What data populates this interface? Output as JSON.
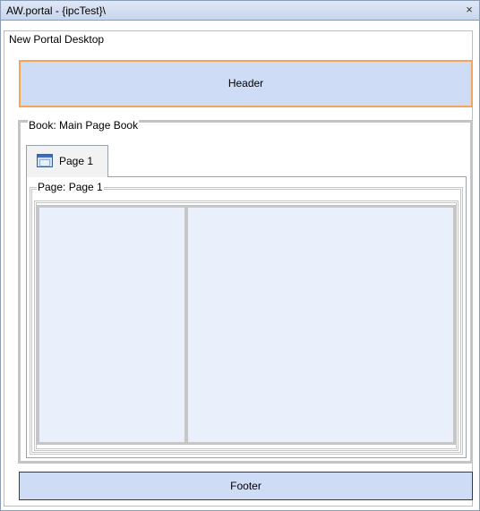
{
  "window": {
    "title": "AW.portal - {ipcTest}\\",
    "close_label": "×"
  },
  "desktop": {
    "legend": "New Portal Desktop",
    "header_label": "Header",
    "footer_label": "Footer"
  },
  "book": {
    "legend": "Book: Main Page Book",
    "tabs": [
      {
        "label": "Page 1",
        "icon": "page-icon"
      }
    ]
  },
  "page": {
    "legend": "Page: Page 1",
    "columns": [
      "left-column",
      "right-column"
    ]
  },
  "colors": {
    "header_border": "#f4a55a",
    "region_fill": "#cfdcf5",
    "column_fill": "#eaf0fb",
    "titlebar": "#c8d6ec"
  }
}
